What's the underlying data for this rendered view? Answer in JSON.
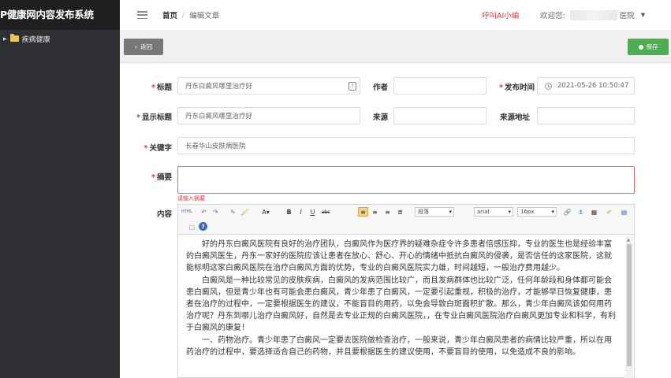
{
  "app": {
    "brand": "P健康网内容发布系统"
  },
  "sidebar": {
    "tree": [
      {
        "label": "疾病健康"
      }
    ]
  },
  "header": {
    "breadcrumb_home": "首页",
    "breadcrumb_sep": "/",
    "breadcrumb_current": "编辑文章",
    "ai_link": "呼叫AI小编",
    "welcome_label": "欢迎您:",
    "welcome_suffix": "医院"
  },
  "toolbar": {
    "back_label": "返回",
    "save_label": "保存"
  },
  "form": {
    "title_label": "标题",
    "title_value": "丹东白癜风哪里治疗好",
    "author_label": "作者",
    "author_value": "",
    "publish_time_label": "发布时间",
    "publish_time_value": "2021-05-26 10:50:47",
    "display_title_label": "显示标题",
    "display_title_value": "丹东白癜风哪里治疗好",
    "source_label": "来源",
    "source_value": "",
    "source_url_label": "来源地址",
    "source_url_value": "",
    "keywords_label": "关键字",
    "keywords_value": "长春华山皮肤病医院",
    "summary_label": "摘要",
    "summary_value": "",
    "summary_error": "请输入摘要",
    "content_label": "内容",
    "required_mark": "*"
  },
  "editor": {
    "toolbar": {
      "html_label": "HTML",
      "font_color_label": "A",
      "bold": "B",
      "italic": "I",
      "underline": "U",
      "strike": "abc",
      "paragraph_select": "段落",
      "font_family_select": "arial",
      "font_size_select": "16px",
      "help": "?"
    },
    "paragraphs": [
      "好的丹东白癜风医院有良好的治疗团队，白癜风作为医疗界的疑难杂症令许多患者倍感压抑，专业的医生也是经验丰富的白癜风医生，丹东一家好的医院应该让患者在放心、舒心、开心的情绪中抵抗白癜风的侵袭，是否信任的这家医院，这就能标明这家白癜风医院在治疗白癜风方面的优势，专业的白癜风医院实力雄，时间越短，一般治疗费用越少。",
      "白癜风是一种比较常见的皮肤疾病，白癜风的发病范围比较广，而且发病群体也比较广泛，任何年龄段和身体都可能会患白癜风，但是青少年也有可能会患白癜风，青少年患了白癜风，一定要引起重视，积极的治疗，才能够早日恢复健康，患者在治疗的过程中，一定要根据医生的建议，不能盲目的用药，以免会导致白斑面积扩散。那么，青少年白癜风该如何用药治疗呢？丹东到哪儿治疗白癜风好，自然是去专业正规的白癜风医院，，在专业白癜风医院治疗白癜风更加专业和科学，有利于白癜风的康复！",
      "一、药物治疗。青少年患了白癜风一定要去医院做检查治疗，一般来说，青少年白癜风患者的病情比较严重，所以在用药治疗的过程中，要选择适合自己的药物，并且要根据医生的建议使用，不要盲目的使用，以免造成不良的影响。"
    ]
  }
}
